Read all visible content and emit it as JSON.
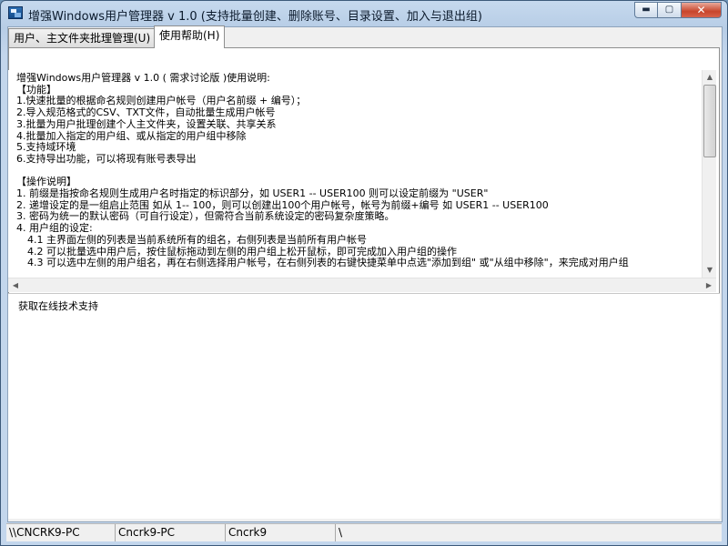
{
  "window": {
    "title": "增强Windows用户管理器 v 1.0 (支持批量创建、删除账号、目录设置、加入与退出组)",
    "buttons": {
      "minimize": "▬",
      "maximize": "▢",
      "close": "✕"
    }
  },
  "tabs": [
    {
      "label": "用户、主文件夹批理管理(U)",
      "active": false
    },
    {
      "label": "使用帮助(H)",
      "active": true
    }
  ],
  "help": {
    "lines": [
      {
        "text": "增强Windows用户管理器 v 1.0 ( 需求讨论版 )使用说明:",
        "indent": false
      },
      {
        "text": "【功能】",
        "indent": false
      },
      {
        "text": "1.快速批量的根据命名规则创建用户帐号（用户名前缀 + 编号）；",
        "indent": false
      },
      {
        "text": "2.导入规范格式的CSV、TXT文件，自动批量生成用户帐号",
        "indent": false
      },
      {
        "text": "3.批量为用户批理创建个人主文件夹，设置关联、共享关系",
        "indent": false
      },
      {
        "text": "4.批量加入指定的用户组、或从指定的用户组中移除",
        "indent": false
      },
      {
        "text": "5.支持域环境",
        "indent": false
      },
      {
        "text": "6.支持导出功能，可以将现有账号表导出",
        "indent": false
      },
      {
        "text": "",
        "indent": false
      },
      {
        "text": "【操作说明】",
        "indent": false
      },
      {
        "text": "1. 前缀是指按命名规则生成用户名时指定的标识部分，如 USER1 -- USER100 则可以设定前缀为 \"USER\"",
        "indent": false
      },
      {
        "text": "2. 递增设定的是一组启止范围 如从 1-- 100，则可以创建出100个用户帐号，帐号为前缀+编号 如 USER1 -- USER100",
        "indent": false
      },
      {
        "text": "3. 密码为统一的默认密码（可自行设定），但需符合当前系统设定的密码复杂度策略。",
        "indent": false
      },
      {
        "text": "4. 用户组的设定:",
        "indent": false
      },
      {
        "text": "4.1 主界面左侧的列表是当前系统所有的组名，右侧列表是当前所有用户帐号",
        "indent": true
      },
      {
        "text": "4.2 可以批量选中用户后，按住鼠标拖动到左侧的用户组上松开鼠标，即可完成加入用户组的操作",
        "indent": true
      },
      {
        "text": "4.3 可以选中左侧的用户组名，再在右侧选择用户帐号，在右侧列表的右键快捷菜单中点选\"添加到组\" 或\"从组中移除\"，来完成对用户组",
        "indent": true
      }
    ]
  },
  "support": {
    "label": "获取在线技术支持"
  },
  "statusbar": {
    "panes": [
      "\\\\CNCRK9-PC",
      "Cncrk9-PC",
      "Cncrk9",
      "\\"
    ]
  }
}
